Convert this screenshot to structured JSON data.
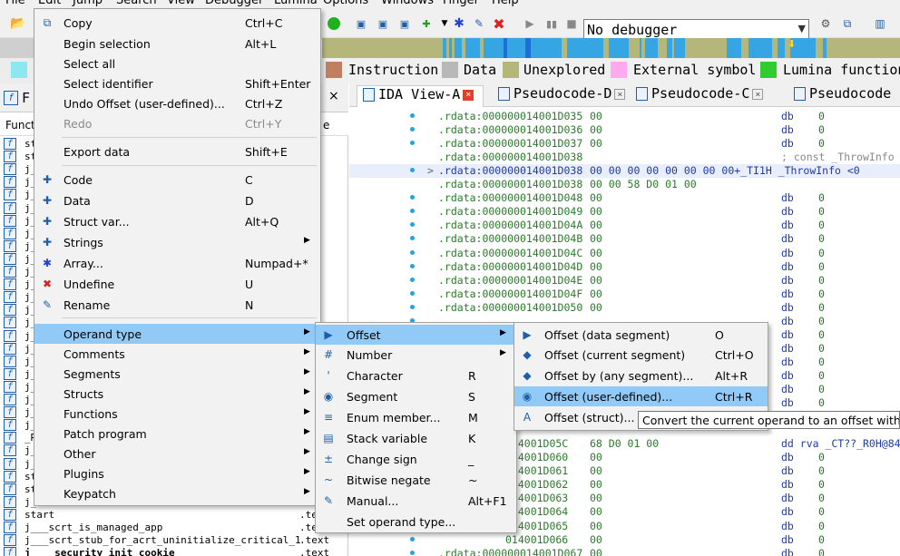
{
  "menubar": {
    "items": [
      "File",
      "Edit",
      "Jump",
      "Search",
      "View",
      "Debugger",
      "Lumina",
      "Options",
      "Windows",
      "Finger",
      "Help"
    ]
  },
  "toolbar": {
    "debugger_value": "No debugger"
  },
  "legend": {
    "items": [
      {
        "label": "Instruction",
        "color": "#c08060"
      },
      {
        "label": "Data",
        "color": "#b8b8b8"
      },
      {
        "label": "Unexplored",
        "color": "#b5b77a"
      },
      {
        "label": "External symbol",
        "color": "#ffaaee"
      },
      {
        "label": "Lumina function",
        "color": "#30cc30"
      }
    ]
  },
  "left_panel": {
    "title": "F",
    "close_label": "×",
    "column_header": "Funct",
    "functions": [
      {
        "name": "st",
        "seg": ""
      },
      {
        "name": "st",
        "seg": ""
      },
      {
        "name": "j_",
        "seg": ""
      },
      {
        "name": "j_",
        "seg": ""
      },
      {
        "name": "j_",
        "seg": ""
      },
      {
        "name": "j_",
        "seg": ""
      },
      {
        "name": "j_",
        "seg": ""
      },
      {
        "name": "j_",
        "seg": ""
      },
      {
        "name": "j_",
        "seg": ""
      },
      {
        "name": "j_",
        "seg": ""
      },
      {
        "name": "j_",
        "seg": ""
      },
      {
        "name": "j_",
        "seg": ""
      },
      {
        "name": "j_",
        "seg": ""
      },
      {
        "name": "j_",
        "seg": ""
      },
      {
        "name": "j_",
        "seg": ""
      },
      {
        "name": "j_",
        "seg": ""
      },
      {
        "name": "j_",
        "seg": ""
      },
      {
        "name": "j_",
        "seg": ""
      },
      {
        "name": "j_",
        "seg": ""
      },
      {
        "name": "j_",
        "seg": ""
      },
      {
        "name": "j_",
        "seg": ""
      },
      {
        "name": "j_",
        "seg": ""
      },
      {
        "name": "j_",
        "seg": ""
      },
      {
        "name": "_R",
        "seg": ""
      },
      {
        "name": "j_",
        "seg": ""
      },
      {
        "name": "j_",
        "seg": ""
      },
      {
        "name": "st",
        "seg": ""
      },
      {
        "name": "st",
        "seg": ""
      },
      {
        "name": "j_",
        "seg": ""
      },
      {
        "name": "start",
        "seg": ".tex"
      },
      {
        "name": "j___scrt_is_managed_app",
        "seg": ".tex"
      },
      {
        "name": "j___scrt_stub_for_acrt_uninitialize_critical_1",
        "seg": ".text"
      },
      {
        "name": "j____security_init_cookie",
        "seg": ".text"
      }
    ]
  },
  "tabs": [
    {
      "label": "IDA View-A",
      "active": true
    },
    {
      "label": "Pseudocode-D",
      "active": false
    },
    {
      "label": "Pseudocode-C",
      "active": false
    },
    {
      "label": "Pseudocode",
      "active": false
    }
  ],
  "ida_lines": [
    {
      "addr": ".rdata:000000014001D035",
      "bytes": "00",
      "mnem": "db",
      "op": "0"
    },
    {
      "addr": ".rdata:000000014001D036",
      "bytes": "00",
      "mnem": "db",
      "op": "0"
    },
    {
      "addr": ".rdata:000000014001D037",
      "bytes": "00",
      "mnem": "db",
      "op": "0"
    },
    {
      "addr": ".rdata:000000014001D038",
      "bytes": "",
      "mnem": "",
      "op": "",
      "comment": "; const _ThrowInfo"
    },
    {
      "addr": ".rdata:000000014001D038",
      "bytes": "00 00 00 00 00 00 00 00+_TI1H _ThrowInfo <0",
      "mnem": "",
      "op": "",
      "highlight": true
    },
    {
      "addr": ".rdata:000000014001D038",
      "bytes": "00 00 58 D0 01 00",
      "mnem": "",
      "op": ""
    },
    {
      "addr": ".rdata:000000014001D048",
      "bytes": "00",
      "mnem": "db",
      "op": "0"
    },
    {
      "addr": ".rdata:000000014001D049",
      "bytes": "00",
      "mnem": "db",
      "op": "0"
    },
    {
      "addr": ".rdata:000000014001D04A",
      "bytes": "00",
      "mnem": "db",
      "op": "0"
    },
    {
      "addr": ".rdata:000000014001D04B",
      "bytes": "00",
      "mnem": "db",
      "op": "0"
    },
    {
      "addr": ".rdata:000000014001D04C",
      "bytes": "00",
      "mnem": "db",
      "op": "0"
    },
    {
      "addr": ".rdata:000000014001D04D",
      "bytes": "00",
      "mnem": "db",
      "op": "0"
    },
    {
      "addr": ".rdata:000000014001D04E",
      "bytes": "00",
      "mnem": "db",
      "op": "0"
    },
    {
      "addr": ".rdata:000000014001D04F",
      "bytes": "00",
      "mnem": "db",
      "op": "0"
    },
    {
      "addr": ".rdata:000000014001D050",
      "bytes": "00",
      "mnem": "db",
      "op": "0"
    },
    {
      "addr": "",
      "bytes": "",
      "mnem": "db",
      "op": "0"
    },
    {
      "addr": "",
      "bytes": "",
      "mnem": "db",
      "op": "0"
    },
    {
      "addr": "",
      "bytes": "",
      "mnem": "db",
      "op": "0"
    },
    {
      "addr": "",
      "bytes": "",
      "mnem": "db",
      "op": "0"
    },
    {
      "addr": "",
      "bytes": "",
      "mnem": "db",
      "op": "0"
    },
    {
      "addr": "",
      "bytes": "",
      "mnem": "db",
      "op": "0"
    },
    {
      "addr": "",
      "bytes": "",
      "mnem": "db",
      "op": "0"
    },
    {
      "addr": "",
      "bytes": "",
      "mnem": "db",
      "op": "0"
    },
    {
      "addr": "",
      "bytes": "",
      "mnem": "",
      "op": ""
    },
    {
      "addr": "014001D05C",
      "bytes": "68 D0 01 00",
      "mnem": "dd rva _CT??_R0H@84",
      "op": ""
    },
    {
      "addr": "014001D060",
      "bytes": "00",
      "mnem": "db",
      "op": "0"
    },
    {
      "addr": "014001D061",
      "bytes": "00",
      "mnem": "db",
      "op": "0"
    },
    {
      "addr": "014001D062",
      "bytes": "00",
      "mnem": "db",
      "op": "0"
    },
    {
      "addr": "014001D063",
      "bytes": "00",
      "mnem": "db",
      "op": "0"
    },
    {
      "addr": "014001D064",
      "bytes": "00",
      "mnem": "db",
      "op": "0"
    },
    {
      "addr": "014001D065",
      "bytes": "00",
      "mnem": "db",
      "op": "0"
    },
    {
      "addr": "014001D066",
      "bytes": "00",
      "mnem": "db",
      "op": "0"
    },
    {
      "addr": ".rdata:000000014001D067",
      "bytes": "00",
      "mnem": "db",
      "op": "0"
    }
  ],
  "main_menu": {
    "items": [
      {
        "label": "Copy",
        "shortcut": "Ctrl+C",
        "icon": "copy-icon",
        "glyph": "⧉"
      },
      {
        "label": "Begin selection",
        "shortcut": "Alt+L"
      },
      {
        "label": "Select all",
        "shortcut": ""
      },
      {
        "label": "Select identifier",
        "shortcut": "Shift+Enter"
      },
      {
        "label": "Undo Offset (user-defined)...",
        "shortcut": "Ctrl+Z"
      },
      {
        "label": "Redo",
        "shortcut": "Ctrl+Y",
        "disabled": true
      },
      {
        "label": "Export data",
        "shortcut": "Shift+E"
      },
      {
        "label": "Code",
        "shortcut": "C",
        "icon": "code-icon",
        "glyph": "✚"
      },
      {
        "label": "Data",
        "shortcut": "D",
        "icon": "data-icon",
        "glyph": "✚"
      },
      {
        "label": "Struct var...",
        "shortcut": "Alt+Q",
        "icon": "struct-var-icon",
        "glyph": "✚"
      },
      {
        "label": "Strings",
        "shortcut": "",
        "submenu": true,
        "icon": "strings-icon",
        "glyph": "✚"
      },
      {
        "label": "Array...",
        "shortcut": "Numpad+*",
        "icon": "array-icon",
        "glyph": "✱"
      },
      {
        "label": "Undefine",
        "shortcut": "U",
        "icon": "undefine-icon",
        "glyph": "✖"
      },
      {
        "label": "Rename",
        "shortcut": "N",
        "icon": "rename-icon",
        "glyph": "✎"
      },
      {
        "label": "Operand type",
        "shortcut": "",
        "submenu": true,
        "selected": true
      },
      {
        "label": "Comments",
        "shortcut": "",
        "submenu": true
      },
      {
        "label": "Segments",
        "shortcut": "",
        "submenu": true
      },
      {
        "label": "Structs",
        "shortcut": "",
        "submenu": true
      },
      {
        "label": "Functions",
        "shortcut": "",
        "submenu": true
      },
      {
        "label": "Patch program",
        "shortcut": "",
        "submenu": true
      },
      {
        "label": "Other",
        "shortcut": "",
        "submenu": true
      },
      {
        "label": "Plugins",
        "shortcut": "",
        "submenu": true
      },
      {
        "label": "Keypatch",
        "shortcut": "",
        "submenu": true
      }
    ]
  },
  "operand_menu": {
    "items": [
      {
        "label": "Offset",
        "shortcut": "",
        "submenu": true,
        "selected": true,
        "icon": "offset-icon",
        "glyph": "▶"
      },
      {
        "label": "Number",
        "shortcut": "",
        "submenu": true,
        "icon": "number-icon",
        "glyph": "#"
      },
      {
        "label": "Character",
        "shortcut": "R",
        "icon": "character-icon",
        "glyph": "'"
      },
      {
        "label": "Segment",
        "shortcut": "S",
        "icon": "segment-icon",
        "glyph": "◉"
      },
      {
        "label": "Enum member...",
        "shortcut": "M",
        "icon": "enum-icon",
        "glyph": "≡"
      },
      {
        "label": "Stack variable",
        "shortcut": "K",
        "icon": "stack-variable-icon",
        "glyph": "▤"
      },
      {
        "label": "Change sign",
        "shortcut": "_",
        "icon": "change-sign-icon",
        "glyph": "±"
      },
      {
        "label": "Bitwise negate",
        "shortcut": "~",
        "icon": "bitwise-negate-icon",
        "glyph": "~"
      },
      {
        "label": "Manual...",
        "shortcut": "Alt+F1",
        "icon": "manual-icon",
        "glyph": "✎"
      },
      {
        "label": "Set operand type...",
        "shortcut": ""
      }
    ]
  },
  "offset_menu": {
    "items": [
      {
        "label": "Offset (data segment)",
        "shortcut": "O",
        "icon": "offset-data-icon",
        "glyph": "▶"
      },
      {
        "label": "Offset (current segment)",
        "shortcut": "Ctrl+O",
        "icon": "offset-current-icon",
        "glyph": "◆"
      },
      {
        "label": "Offset by (any segment)...",
        "shortcut": "Alt+R",
        "icon": "offset-any-icon",
        "glyph": "◆"
      },
      {
        "label": "Offset (user-defined)...",
        "shortcut": "Ctrl+R",
        "selected": true,
        "icon": "offset-user-icon",
        "glyph": "◉"
      },
      {
        "label": "Offset (struct)...",
        "shortcut": "",
        "icon": "offset-struct-icon",
        "glyph": "A"
      }
    ]
  },
  "tooltip": {
    "text": "Convert the current operand to an offset with any"
  }
}
